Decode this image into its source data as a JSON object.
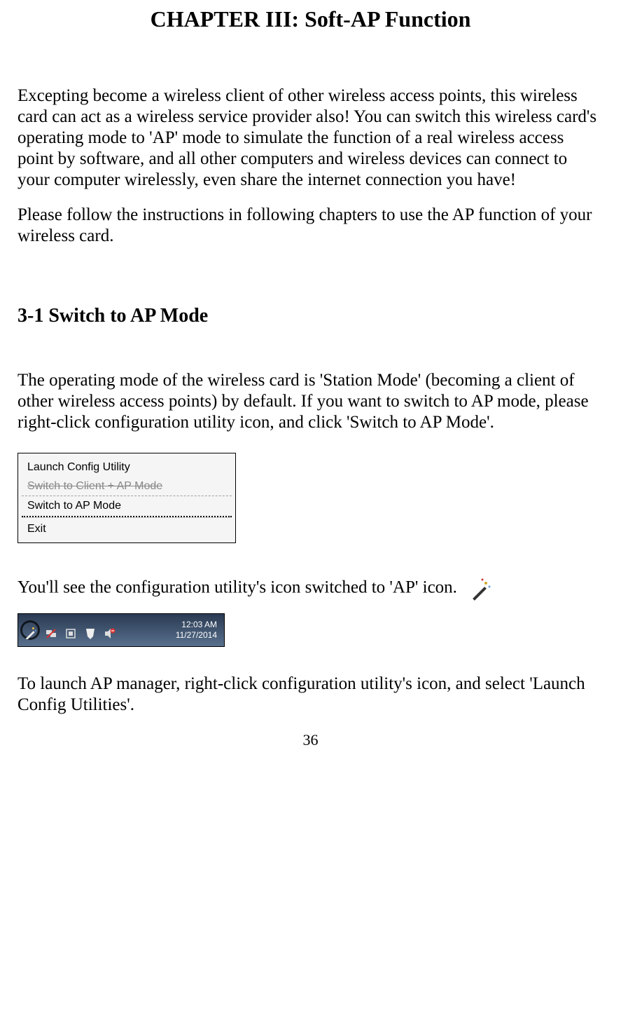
{
  "chapter_title": "CHAPTER III: Soft-AP Function",
  "intro_para1": "Excepting become a wireless client of other wireless access points, this wireless card can act as a wireless service provider also! You can switch this wireless card's operating mode to 'AP' mode to simulate the function of a real wireless access point by software, and all other computers and wireless devices can connect to your computer wirelessly, even share the internet connection you have!",
  "intro_para2": "Please follow the instructions in following chapters to use the AP function of your wireless card.",
  "section_title": "3-1 Switch to AP Mode",
  "section_para1": "The operating mode of the wireless card is 'Station Mode' (becoming a client of other wireless access points) by default. If you want to switch to AP mode, please right-click configuration utility icon, and click 'Switch to AP Mode'.",
  "context_menu": {
    "items": [
      {
        "label": "Launch Config Utility",
        "state": "normal"
      },
      {
        "label": "Switch to Client + AP Mode",
        "state": "strike"
      },
      {
        "label": "Switch to AP Mode",
        "state": "highlight"
      },
      {
        "label": "Exit",
        "state": "normal"
      }
    ]
  },
  "section_para2": "You'll see the configuration utility's icon switched to 'AP' icon.",
  "tray": {
    "time": "12:03 AM",
    "date": "11/27/2014",
    "icons": [
      {
        "name": "ap-wand-icon",
        "circled": true
      },
      {
        "name": "network-disconnected-icon",
        "circled": false
      },
      {
        "name": "device-icon",
        "circled": false
      },
      {
        "name": "action-center-icon",
        "circled": false
      },
      {
        "name": "volume-muted-icon",
        "circled": false
      }
    ]
  },
  "section_para3": "To launch AP manager, right-click configuration utility's icon, and select 'Launch Config Utilities'.",
  "page_number": "36"
}
